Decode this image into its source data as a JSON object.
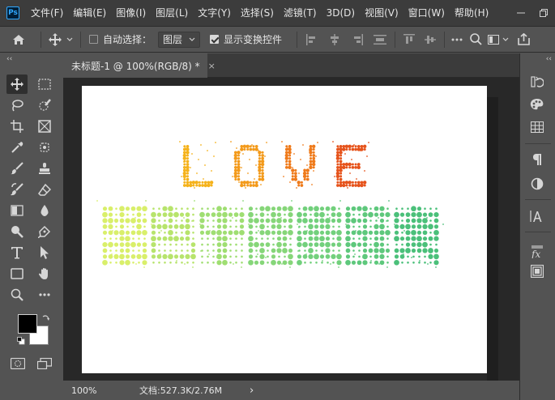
{
  "app": {
    "logo_text": "Ps"
  },
  "menu": {
    "items": [
      "文件(F)",
      "编辑(E)",
      "图像(I)",
      "图层(L)",
      "文字(Y)",
      "选择(S)",
      "滤镜(T)",
      "3D(D)",
      "视图(V)",
      "窗口(W)",
      "帮助(H)"
    ]
  },
  "options_bar": {
    "auto_select_label": "自动选择：",
    "auto_select_checked": false,
    "auto_select_target": "图层",
    "show_transform_label": "显示变换控件",
    "show_transform_checked": true
  },
  "toolbar": {
    "collapse_glyph": "‹‹",
    "foreground_color": "#000000",
    "background_color": "#ffffff"
  },
  "document": {
    "tab_title": "未标题-1 @ 100%(RGB/8) *",
    "tab_close": "×",
    "canvas_text_line1": "LOVE",
    "canvas_text_line2": "紫色中秋节快乐",
    "line1_colors": [
      "#f5b21a",
      "#f39a1a",
      "#ef7a1a",
      "#e6531b"
    ],
    "line2_colors": [
      "#d9ef6a",
      "#b7e46c",
      "#9fde72",
      "#86d679",
      "#72d07c",
      "#5ec87c",
      "#4bc07a"
    ]
  },
  "status": {
    "zoom": "100%",
    "doc_info": "文档:527.3K/2.76M",
    "arrow": "›"
  },
  "right_panel": {
    "collapse_glyph": "‹‹",
    "items": [
      "history-icon",
      "color-icon",
      "swatches-icon",
      "paragraph-icon",
      "adjustments-icon",
      "character-icon",
      "styles-icon",
      "layers-icon"
    ]
  }
}
